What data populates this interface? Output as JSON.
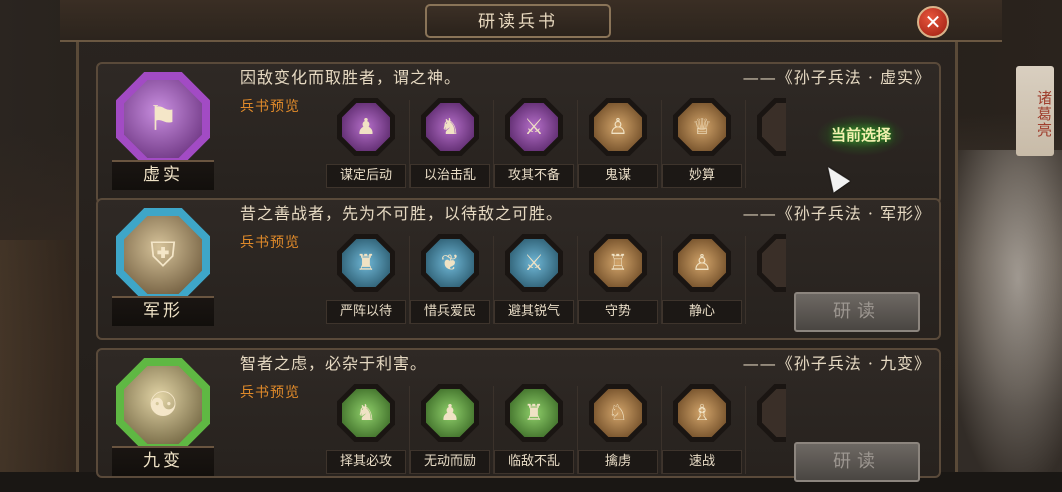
{
  "window": {
    "title": "研读兵书",
    "close_glyph": "✕"
  },
  "side_banner": "诸葛亮",
  "cards": [
    {
      "emblem_name": "虚实",
      "emblem_icon": "banner-icon",
      "emblem_color": "#a24bc4",
      "quote": "因敌变化而取胜者，谓之神。",
      "source": "——《孙子兵法 · 虚实》",
      "preview_label": "兵书预览",
      "skills": [
        "谋定后动",
        "以治击乱",
        "攻其不备",
        "鬼谋",
        "妙算"
      ],
      "status": "当前选择"
    },
    {
      "emblem_name": "军形",
      "emblem_icon": "shield-icon",
      "emblem_color": "#3ea6c8",
      "quote": "昔之善战者，先为不可胜，以待敌之可胜。",
      "source": "——《孙子兵法 · 军形》",
      "preview_label": "兵书预览",
      "skills": [
        "严阵以待",
        "惜兵爱民",
        "避其锐气",
        "守势",
        "静心"
      ],
      "button": "研读"
    },
    {
      "emblem_name": "九变",
      "emblem_icon": "yin-yang-icon",
      "emblem_color": "#5fb843",
      "quote": "智者之虑，必杂于利害。",
      "source": "——《孙子兵法 · 九变》",
      "preview_label": "兵书预览",
      "skills": [
        "择其必攻",
        "无动而励",
        "临敌不乱",
        "擒虏",
        "速战"
      ],
      "button": "研读"
    }
  ]
}
